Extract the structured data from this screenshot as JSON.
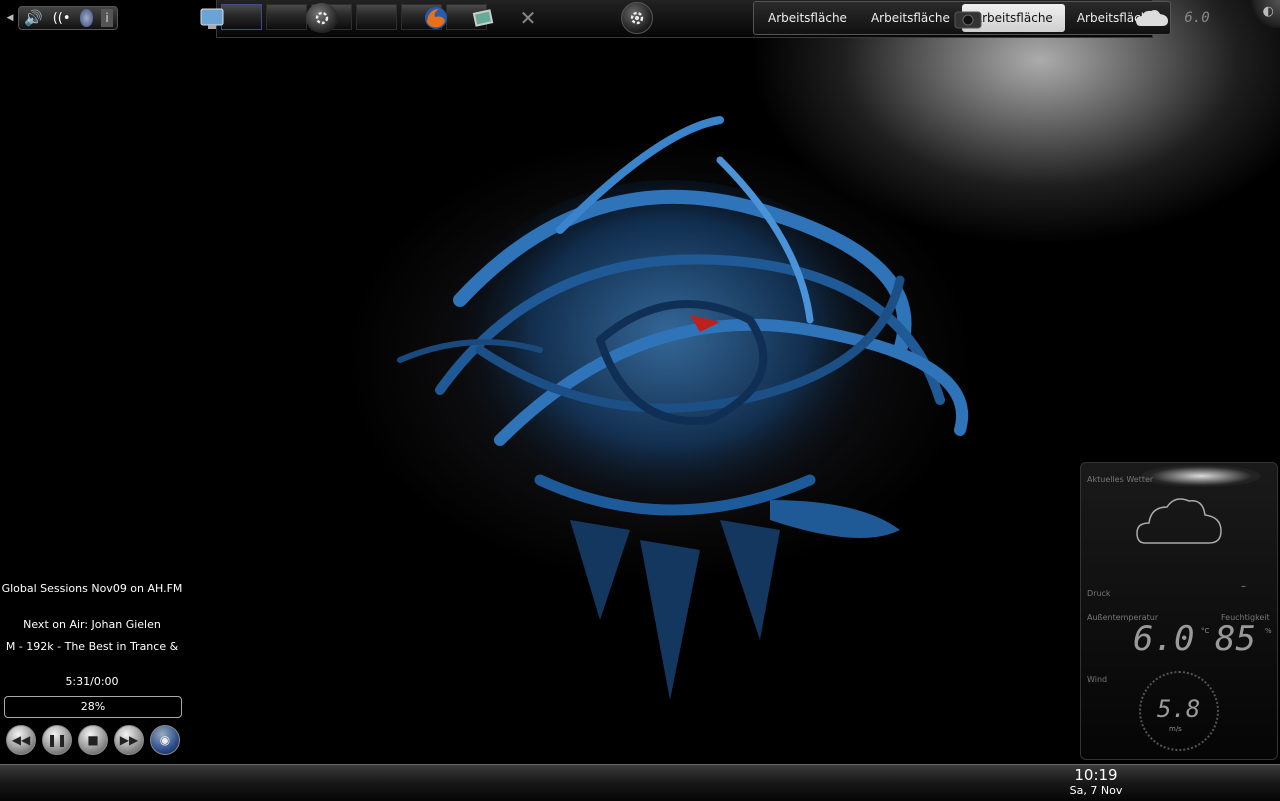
{
  "pager": {
    "desktops": [
      "Arbeitsfläche",
      "Arbeitsfläche",
      "Arbeitsfläche",
      "Arbeitsfläche"
    ],
    "active_desktop_index": 2,
    "thumbnail_count": 6,
    "active_thumbnail_index": 0,
    "kicker_icon": "gear-icon"
  },
  "media_player": {
    "title": "Global Sessions Nov09 on AH.FM",
    "next_on_air": "Next on Air:  Johan Gielen",
    "station": "M - 192k - The Best in Trance &",
    "time": "5:31/0:00",
    "progress": "28%",
    "progress_fraction": 0.28,
    "buttons": [
      "previous-icon",
      "pause-icon",
      "stop-icon",
      "next-icon",
      "amarok-icon"
    ]
  },
  "weather": {
    "label_current": "Aktuelles Wetter",
    "label_pressure": "Druck",
    "label_temp": "Außentemperatur",
    "label_humidity": "Feuchtigkeit",
    "label_wind": "Wind",
    "temperature": "6.0",
    "temp_unit": "°C",
    "humidity": "85",
    "humidity_unit": "%",
    "wind": "5.8",
    "wind_unit": "m/s",
    "pressure": "–"
  },
  "taskbar": {
    "clock_time": "10:19",
    "clock_date": "Sa, 7 Nov",
    "weather_tray_temp": "6.0"
  },
  "colors": {
    "accent_blue": "#2d6fb0",
    "panel_dark": "#1a1a1a",
    "active_tab": "#dcdcdc"
  }
}
